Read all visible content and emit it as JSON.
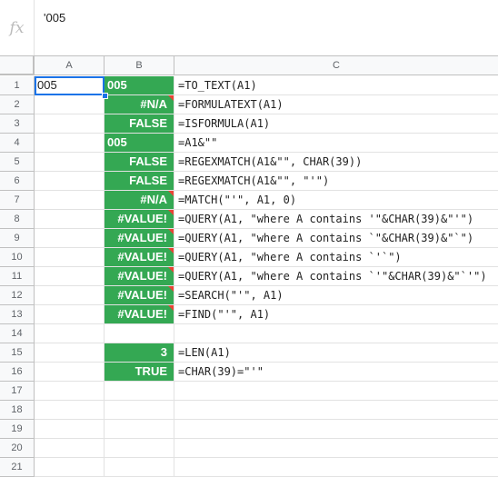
{
  "formula_bar": {
    "fx_label": "fx",
    "content": "'005"
  },
  "column_headers": [
    "A",
    "B",
    "C"
  ],
  "rows": [
    {
      "n": "1",
      "a": "005",
      "b": "005",
      "b_align": "left",
      "b_error": false,
      "c": "=TO_TEXT(A1)"
    },
    {
      "n": "2",
      "a": "",
      "b": "#N/A",
      "b_align": "right",
      "b_error": true,
      "c": "=FORMULATEXT(A1)"
    },
    {
      "n": "3",
      "a": "",
      "b": "FALSE",
      "b_align": "right",
      "b_error": false,
      "c": "=ISFORMULA(A1)"
    },
    {
      "n": "4",
      "a": "",
      "b": "005",
      "b_align": "left",
      "b_error": false,
      "c": "=A1&\"\""
    },
    {
      "n": "5",
      "a": "",
      "b": "FALSE",
      "b_align": "right",
      "b_error": false,
      "c": "=REGEXMATCH(A1&\"\", CHAR(39))"
    },
    {
      "n": "6",
      "a": "",
      "b": "FALSE",
      "b_align": "right",
      "b_error": false,
      "c": "=REGEXMATCH(A1&\"\", \"'\")"
    },
    {
      "n": "7",
      "a": "",
      "b": "#N/A",
      "b_align": "right",
      "b_error": true,
      "c": "=MATCH(\"'\", A1, 0)"
    },
    {
      "n": "8",
      "a": "",
      "b": "#VALUE!",
      "b_align": "right",
      "b_error": true,
      "c": "=QUERY(A1, \"where A contains '\"&CHAR(39)&\"'\")"
    },
    {
      "n": "9",
      "a": "",
      "b": "#VALUE!",
      "b_align": "right",
      "b_error": true,
      "c": "=QUERY(A1, \"where A contains `\"&CHAR(39)&\"`\")"
    },
    {
      "n": "10",
      "a": "",
      "b": "#VALUE!",
      "b_align": "right",
      "b_error": true,
      "c": "=QUERY(A1, \"where A contains `'`\")"
    },
    {
      "n": "11",
      "a": "",
      "b": "#VALUE!",
      "b_align": "right",
      "b_error": true,
      "c": "=QUERY(A1, \"where A contains `'\"&CHAR(39)&\"`'\")"
    },
    {
      "n": "12",
      "a": "",
      "b": "#VALUE!",
      "b_align": "right",
      "b_error": true,
      "c": "=SEARCH(\"'\", A1)"
    },
    {
      "n": "13",
      "a": "",
      "b": "#VALUE!",
      "b_align": "right",
      "b_error": true,
      "c": "=FIND(\"'\", A1)"
    },
    {
      "n": "14",
      "a": "",
      "b": "",
      "b_align": "none",
      "b_error": false,
      "c": ""
    },
    {
      "n": "15",
      "a": "",
      "b": "3",
      "b_align": "right",
      "b_error": false,
      "c": "=LEN(A1)"
    },
    {
      "n": "16",
      "a": "",
      "b": "TRUE",
      "b_align": "right",
      "b_error": false,
      "c": "=CHAR(39)=\"'\""
    },
    {
      "n": "17",
      "a": "",
      "b": "",
      "b_align": "none",
      "b_error": false,
      "c": ""
    },
    {
      "n": "18",
      "a": "",
      "b": "",
      "b_align": "none",
      "b_error": false,
      "c": ""
    },
    {
      "n": "19",
      "a": "",
      "b": "",
      "b_align": "none",
      "b_error": false,
      "c": ""
    },
    {
      "n": "20",
      "a": "",
      "b": "",
      "b_align": "none",
      "b_error": false,
      "c": ""
    },
    {
      "n": "21",
      "a": "",
      "b": "",
      "b_align": "none",
      "b_error": false,
      "c": ""
    }
  ],
  "colors": {
    "result_fill": "#34a853",
    "error_marker": "#ea4335",
    "selection": "#1a73e8"
  }
}
